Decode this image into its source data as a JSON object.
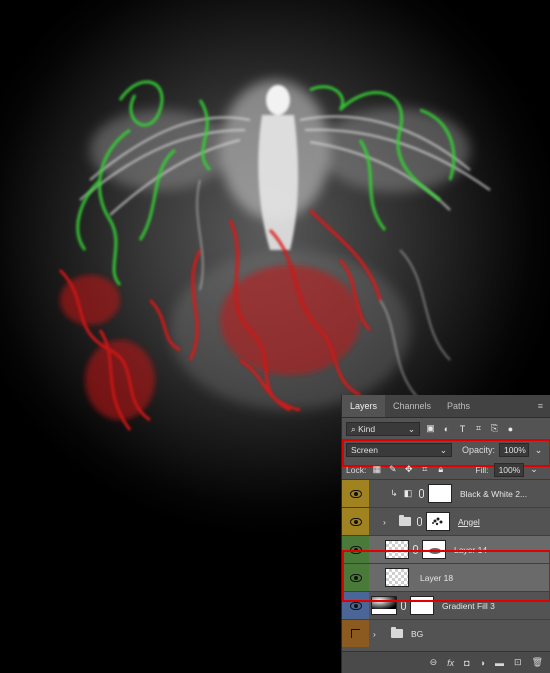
{
  "panel": {
    "tabs": [
      {
        "label": "Layers",
        "active": true
      },
      {
        "label": "Channels",
        "active": false
      },
      {
        "label": "Paths",
        "active": false
      }
    ],
    "filter": {
      "kind_label": "Kind"
    },
    "blend": {
      "mode": "Screen",
      "opacity_label": "Opacity:",
      "opacity_value": "100%"
    },
    "lock": {
      "label": "Lock:",
      "fill_label": "Fill:",
      "fill_value": "100%"
    },
    "layers": [
      {
        "name": "Black & White 2...",
        "type": "adjustment",
        "eye_color": "#a08320",
        "clipped": true
      },
      {
        "name": "Angel",
        "type": "smart-group",
        "eye_color": "#a08320",
        "underlined": true
      },
      {
        "name": "Layer 14",
        "type": "layer-mask",
        "eye_color": "#4a7a3a",
        "highlighted": true
      },
      {
        "name": "Layer 18",
        "type": "layer",
        "eye_color": "#4a7a3a",
        "highlighted": true
      },
      {
        "name": "Gradient Fill 3",
        "type": "gradient-fill",
        "eye_color": "#4b6596"
      },
      {
        "name": "BG",
        "type": "group",
        "eye_color": "#8a5a20",
        "eye_hidden": true
      }
    ],
    "bottom_icons": [
      "link-icon",
      "fx-icon",
      "mask-icon",
      "adjustment-icon",
      "folder-icon",
      "new-layer-icon",
      "trash-icon"
    ]
  },
  "colors": {
    "smoke_green": "#35d235",
    "smoke_red": "#e01818",
    "smoke_white": "#e8e8e8",
    "highlight_red": "#e00000"
  }
}
